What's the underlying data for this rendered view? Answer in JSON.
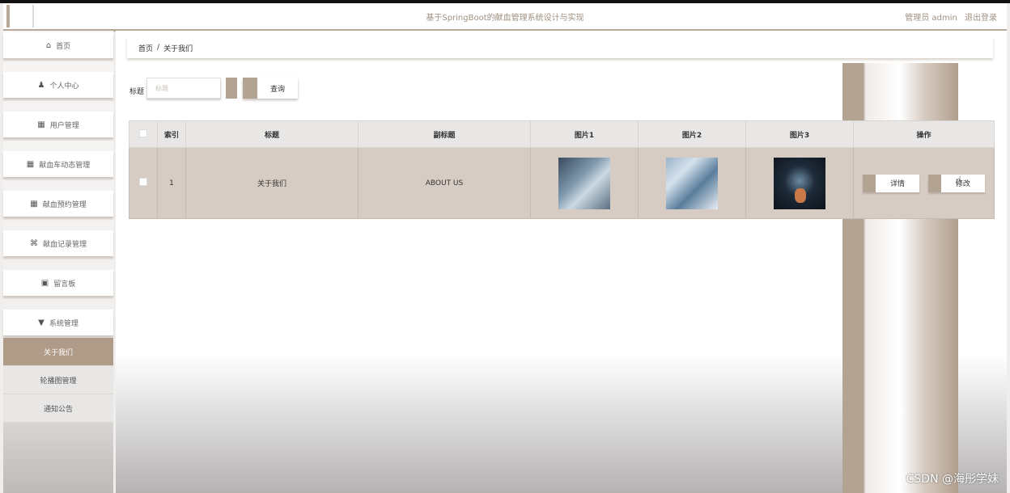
{
  "header": {
    "title": "基于SpringBoot的献血管理系统设计与实现",
    "user_label": "管理员 admin",
    "logout_label": "退出登录"
  },
  "sidebar": {
    "items": [
      {
        "label": "首页",
        "icon": "home-icon"
      },
      {
        "label": "个人中心",
        "icon": "user-icon"
      },
      {
        "label": "用户管理",
        "icon": "grid-icon"
      },
      {
        "label": "献血车动态管理",
        "icon": "grid-icon"
      },
      {
        "label": "献血预约管理",
        "icon": "grid-icon"
      },
      {
        "label": "献血记录管理",
        "icon": "record-icon"
      },
      {
        "label": "留言板",
        "icon": "message-icon"
      },
      {
        "label": "系统管理",
        "icon": "system-icon"
      }
    ],
    "subitems": [
      {
        "label": "关于我们",
        "active": true
      },
      {
        "label": "轮播图管理",
        "active": false
      },
      {
        "label": "通知公告",
        "active": false
      }
    ]
  },
  "breadcrumb": {
    "home": "首页",
    "separator": "/",
    "current": "关于我们"
  },
  "search": {
    "label": "标题",
    "placeholder": "标题",
    "button": "查询"
  },
  "table": {
    "columns": [
      "",
      "索引",
      "标题",
      "副标题",
      "图片1",
      "图片2",
      "图片3",
      "操作"
    ],
    "rows": [
      {
        "index": "1",
        "title": "关于我们",
        "subtitle": "ABOUT US",
        "detail": "详情",
        "edit": "修改"
      }
    ]
  },
  "watermark": "CSDN @海彤学妹",
  "colors": {
    "accent": "#b3a392",
    "row_bg": "#d7ccc4"
  }
}
